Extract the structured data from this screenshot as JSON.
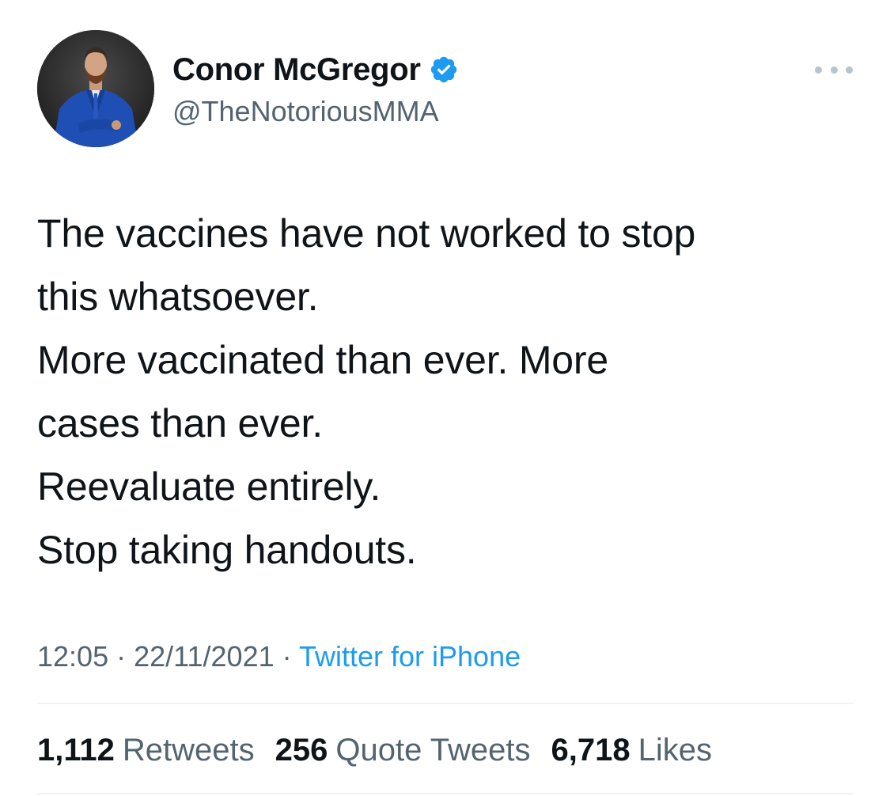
{
  "author": {
    "display_name": "Conor McGregor",
    "handle": "@TheNotoriousMMA",
    "verified": true,
    "avatar_icon": "profile-photo"
  },
  "menu": {
    "icon": "more-options-icon"
  },
  "tweet": {
    "lines": [
      "The vaccines have not worked to stop",
      "this whatsoever.",
      "More vaccinated than ever. More",
      "cases than ever.",
      "Reevaluate entirely.",
      "Stop taking handouts."
    ]
  },
  "meta": {
    "time": "12:05",
    "separator": "·",
    "date": "22/11/2021",
    "source": "Twitter for iPhone"
  },
  "stats": {
    "retweets": {
      "count": "1,112",
      "label": "Retweets"
    },
    "quotes": {
      "count": "256",
      "label": "Quote Tweets"
    },
    "likes": {
      "count": "6,718",
      "label": "Likes"
    }
  },
  "colors": {
    "text": "#0f1419",
    "secondary": "#536471",
    "accent": "#1d9bf0",
    "divider": "#eff3f4"
  }
}
